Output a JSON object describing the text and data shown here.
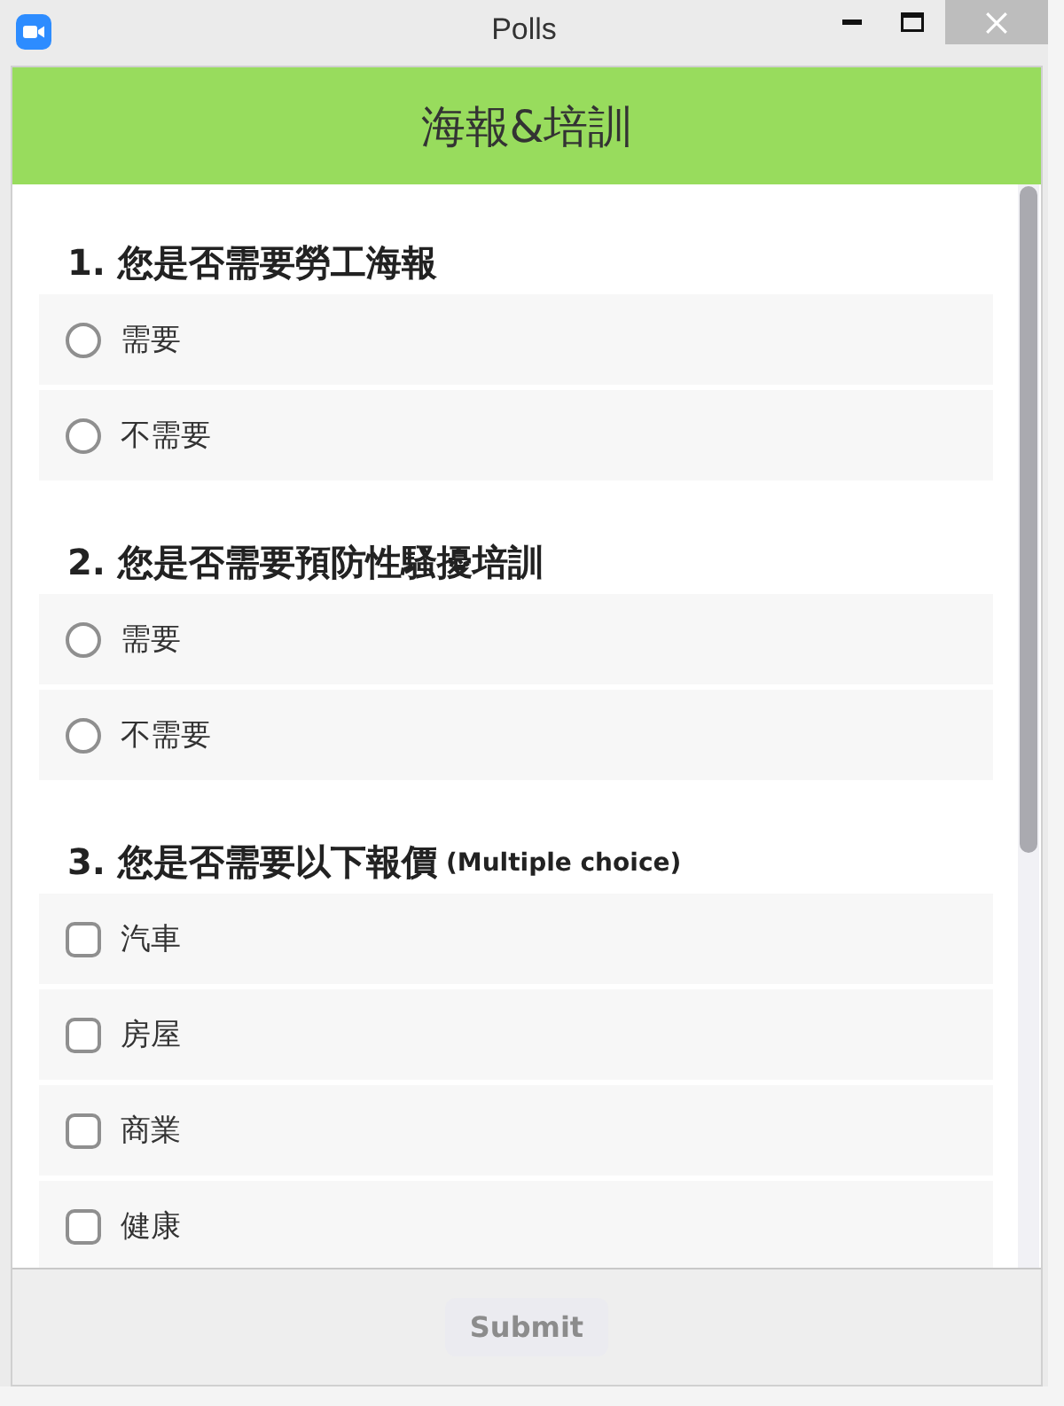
{
  "window": {
    "title": "Polls"
  },
  "poll": {
    "title": "海報&培訓"
  },
  "questions": [
    {
      "kind": "single",
      "title": "1. 您是否需要勞工海報",
      "options": [
        {
          "label": "需要",
          "selected": false
        },
        {
          "label": "不需要",
          "selected": false
        }
      ]
    },
    {
      "kind": "single",
      "title": "2. 您是否需要預防性騷擾培訓",
      "options": [
        {
          "label": "需要",
          "selected": false
        },
        {
          "label": "不需要",
          "selected": false
        }
      ]
    },
    {
      "kind": "multiple",
      "title": "3. 您是否需要以下報價",
      "hint": "(Multiple choice)",
      "options": [
        {
          "label": "汽車",
          "checked": false
        },
        {
          "label": "房屋",
          "checked": false
        },
        {
          "label": "商業",
          "checked": false
        },
        {
          "label": "健康",
          "checked": false
        }
      ]
    }
  ],
  "submit_button": {
    "label": "Submit",
    "disabled": true
  }
}
